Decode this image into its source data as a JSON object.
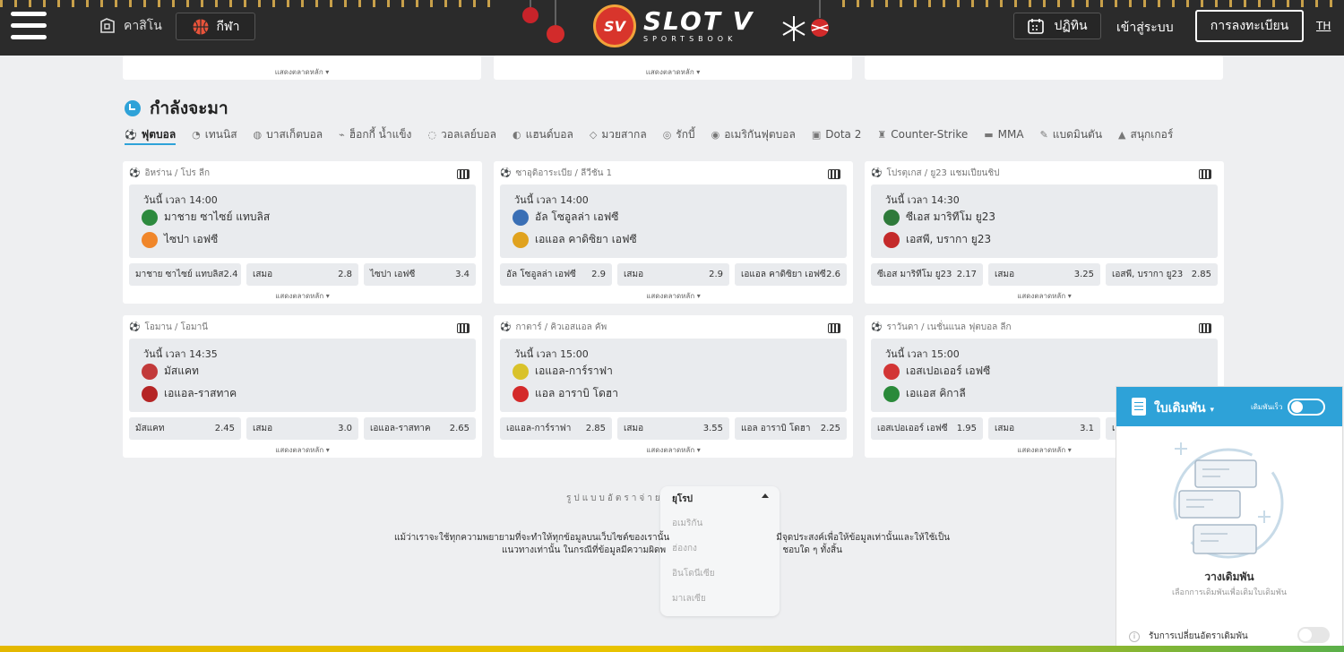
{
  "header": {
    "casino_label": "คาสิโน",
    "sport_label": "กีฬา",
    "logo_mark": "SV",
    "logo_main": "SLOT V",
    "logo_sub": "SPORTSBOOK",
    "calendar_label": "ปฏิทิน",
    "login_label": "เข้าสู่ระบบ",
    "register_label": "การลงทะเบียน",
    "lang_label": "TH"
  },
  "top_cards": {
    "more_label": "แสดงตลาดหลัก"
  },
  "upcoming": {
    "title": "กำลังจะมา",
    "tabs": [
      {
        "label": "ฟุตบอล",
        "icon": "soccer-icon",
        "active": true
      },
      {
        "label": "เทนนิส",
        "icon": "tennis-icon"
      },
      {
        "label": "บาสเก็ตบอล",
        "icon": "basketball-icon"
      },
      {
        "label": "ฮ็อกกี้ น้ำแข็ง",
        "icon": "hockey-icon"
      },
      {
        "label": "วอลเลย์บอล",
        "icon": "volleyball-icon"
      },
      {
        "label": "แฮนด์บอล",
        "icon": "handball-icon"
      },
      {
        "label": "มวยสากล",
        "icon": "boxing-icon"
      },
      {
        "label": "รักบี้",
        "icon": "rugby-icon"
      },
      {
        "label": "อเมริกันฟุตบอล",
        "icon": "american-football-icon"
      },
      {
        "label": "Dota 2",
        "icon": "dota-icon"
      },
      {
        "label": "Counter-Strike",
        "icon": "counter-strike-icon"
      },
      {
        "label": "MMA",
        "icon": "mma-icon"
      },
      {
        "label": "แบดมินตัน",
        "icon": "badminton-icon"
      },
      {
        "label": "สนุกเกอร์",
        "icon": "snooker-icon"
      }
    ],
    "matches": [
      {
        "league": "อิหร่าน / โปร ลีก",
        "time": "วันนี้ เวลา 14:00",
        "home": "มาชาย ซาไซย์ แทบลิส",
        "away": "ไซปา เอฟซี",
        "home_color": "#2d8a3e",
        "away_color": "#f0862a",
        "odds": [
          {
            "label": "มาชาย ซาไซย์ แทบลิส",
            "value": "2.4"
          },
          {
            "label": "เสมอ",
            "value": "2.8"
          },
          {
            "label": "ไซปา เอฟซี",
            "value": "3.4"
          }
        ]
      },
      {
        "league": "ซาอุดิอาระเบีย / ลีวีชัน 1",
        "time": "วันนี้ เวลา 14:00",
        "home": "อัล โซอูลล่า เอฟซี",
        "away": "เอแอล คาดิซิยา เอฟซี",
        "home_color": "#3a6fb5",
        "away_color": "#e0a21e",
        "odds": [
          {
            "label": "อัล โซอูลล่า เอฟซี",
            "value": "2.9"
          },
          {
            "label": "เสมอ",
            "value": "2.9"
          },
          {
            "label": "เอแอล คาดิซิยา เอฟซี",
            "value": "2.6"
          }
        ]
      },
      {
        "league": "โปรตุเกส / ยู23 แชมเปียนชิป",
        "time": "วันนี้ เวลา 14:30",
        "home": "ซีเอส มาริทีโม ยู23",
        "away": "เอสพี, บรากา ยู23",
        "home_color": "#2e7a3a",
        "away_color": "#c42a2a",
        "odds": [
          {
            "label": "ซีเอส มาริทีโม ยู23",
            "value": "2.17"
          },
          {
            "label": "เสมอ",
            "value": "3.25"
          },
          {
            "label": "เอสพี, บรากา ยู23",
            "value": "2.85"
          }
        ]
      },
      {
        "league": "โอมาน / โอมานี",
        "time": "วันนี้ เวลา 14:35",
        "home": "มัสแคท",
        "away": "เอแอล-ราสทาค",
        "home_color": "#c23a3a",
        "away_color": "#b52525",
        "odds": [
          {
            "label": "มัสแคท",
            "value": "2.45"
          },
          {
            "label": "เสมอ",
            "value": "3.0"
          },
          {
            "label": "เอแอล-ราสทาค",
            "value": "2.65"
          }
        ]
      },
      {
        "league": "กาตาร์ / คิวเอสแอล คัพ",
        "time": "วันนี้ เวลา 15:00",
        "home": "เอแอล-การ์ราฟา",
        "away": "แอล อาราบิ โดฮา",
        "home_color": "#d9c22a",
        "away_color": "#d42a2a",
        "odds": [
          {
            "label": "เอแอล-การ์ราฟา",
            "value": "2.85"
          },
          {
            "label": "เสมอ",
            "value": "3.55"
          },
          {
            "label": "แอล อาราบิ โดฮา",
            "value": "2.25"
          }
        ]
      },
      {
        "league": "ราวันดา / เนชั่นแนล ฟุตบอล ลีก",
        "time": "วันนี้ เวลา 15:00",
        "home": "เอสเปอเออร์ เอฟซี",
        "away": "เอแอส คิกาลี",
        "home_color": "#d23535",
        "away_color": "#2a8a3a",
        "odds": [
          {
            "label": "เอสเปอเออร์ เอฟซี",
            "value": "1.95"
          },
          {
            "label": "เสมอ",
            "value": "3.1"
          },
          {
            "label": "เอ",
            "value": ""
          }
        ]
      }
    ]
  },
  "odds_format": {
    "label": "รูปแบบอัตราจ่าย",
    "selected": "ยุโรป",
    "options": [
      "อเมริกัน",
      "ฮ่องกง",
      "อินโดนีเซีย",
      "มาเลเซีย"
    ]
  },
  "disclaimer": {
    "line1": "แม้ว่าเราจะใช้ทุกความพยายามที่จะทำให้ทุกข้อมูลบนเว็บไซต์ของเรานั้น",
    "line1b": "มีจุดประสงค์เพื่อให้ข้อมูลเท่านั้นและให้ใช้เป็น",
    "line2": "แนวทางเท่านั้น ในกรณีที่ข้อมูลมีความผิดพ",
    "line2b": "ชอบใด ๆ ทั้งสิ้น"
  },
  "bet_slip": {
    "title": "ใบเดิมพัน",
    "quick_label": "เดิมพันเร็ว",
    "empty_title": "วางเดิมพัน",
    "empty_sub": "เลือกการเดิมพันเพื่อเติมใบเดิมพัน",
    "accept_label": "รับการเปลี่ยนอัตราเดิมพัน"
  }
}
